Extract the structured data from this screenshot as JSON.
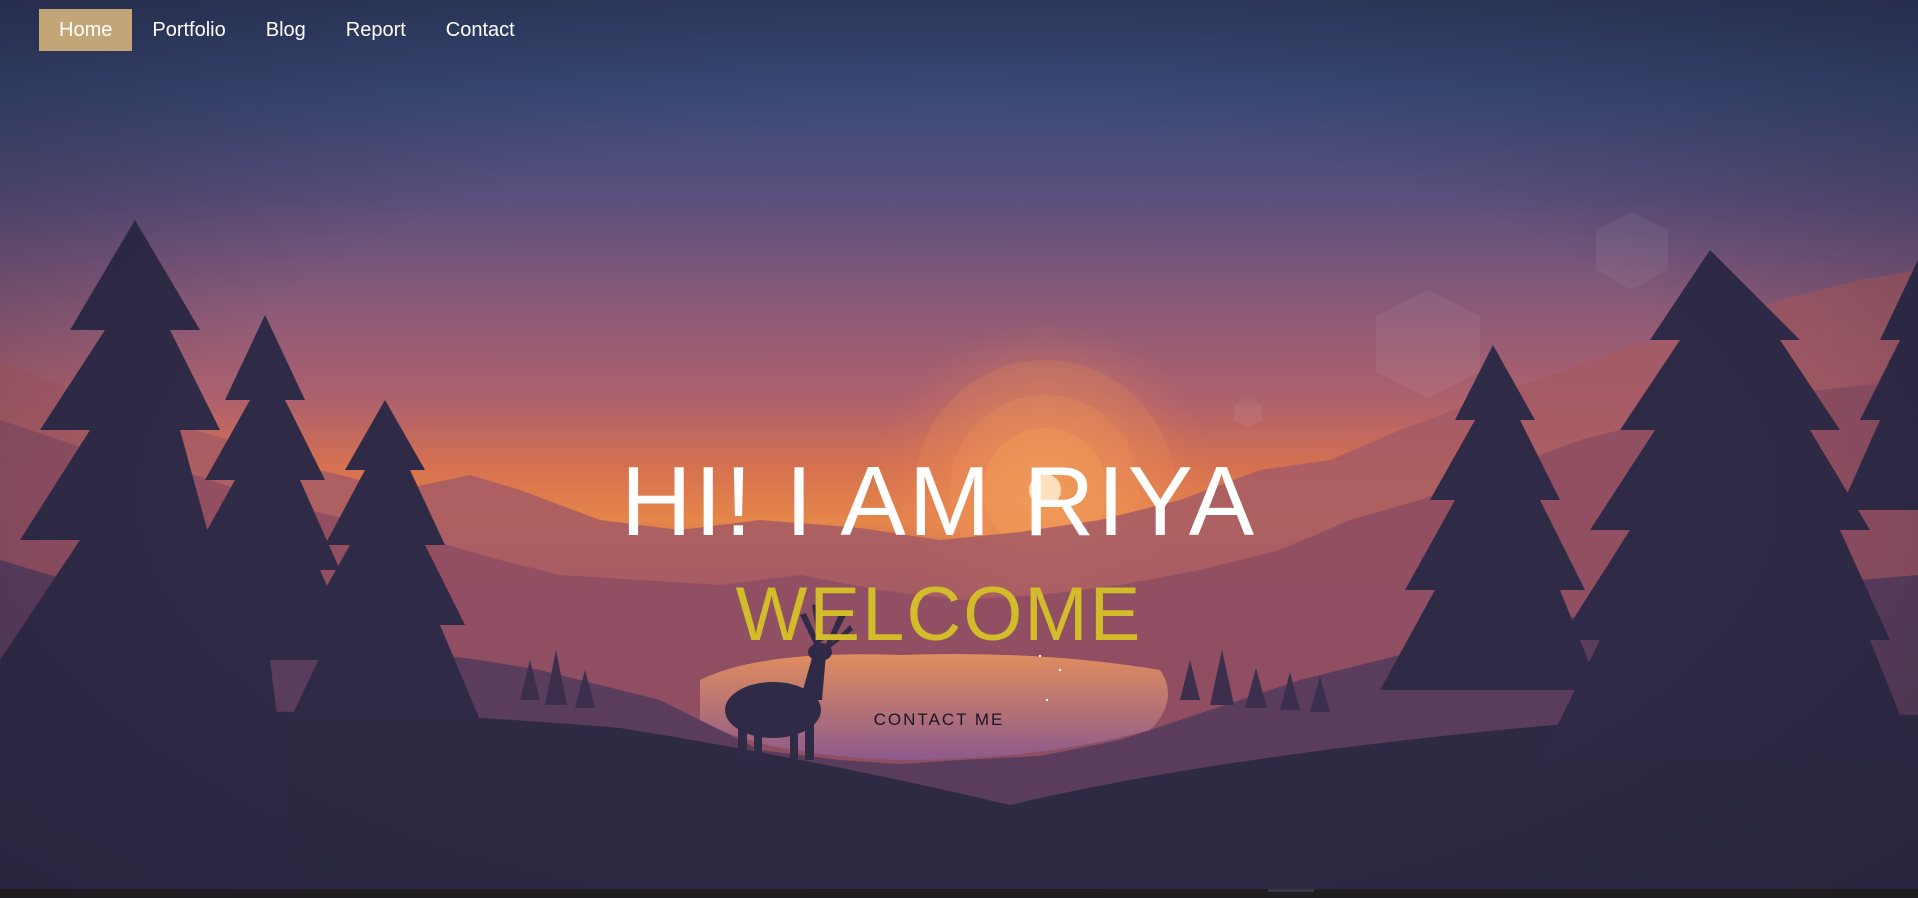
{
  "nav": {
    "items": [
      {
        "label": "Home",
        "active": true
      },
      {
        "label": "Portfolio",
        "active": false
      },
      {
        "label": "Blog",
        "active": false
      },
      {
        "label": "Report",
        "active": false
      },
      {
        "label": "Contact",
        "active": false
      }
    ]
  },
  "hero": {
    "title": "HI! I AM RIYA",
    "subtitle": "WELCOME",
    "cta_label": "CONTACT ME"
  },
  "colors": {
    "nav_active_bg": "#c2a678",
    "subtitle": "#d2bc2a",
    "sky_top": "#34456f",
    "sky_mid": "#a45f72",
    "sky_horizon": "#e8834a",
    "silhouette": "#2e2a44"
  }
}
